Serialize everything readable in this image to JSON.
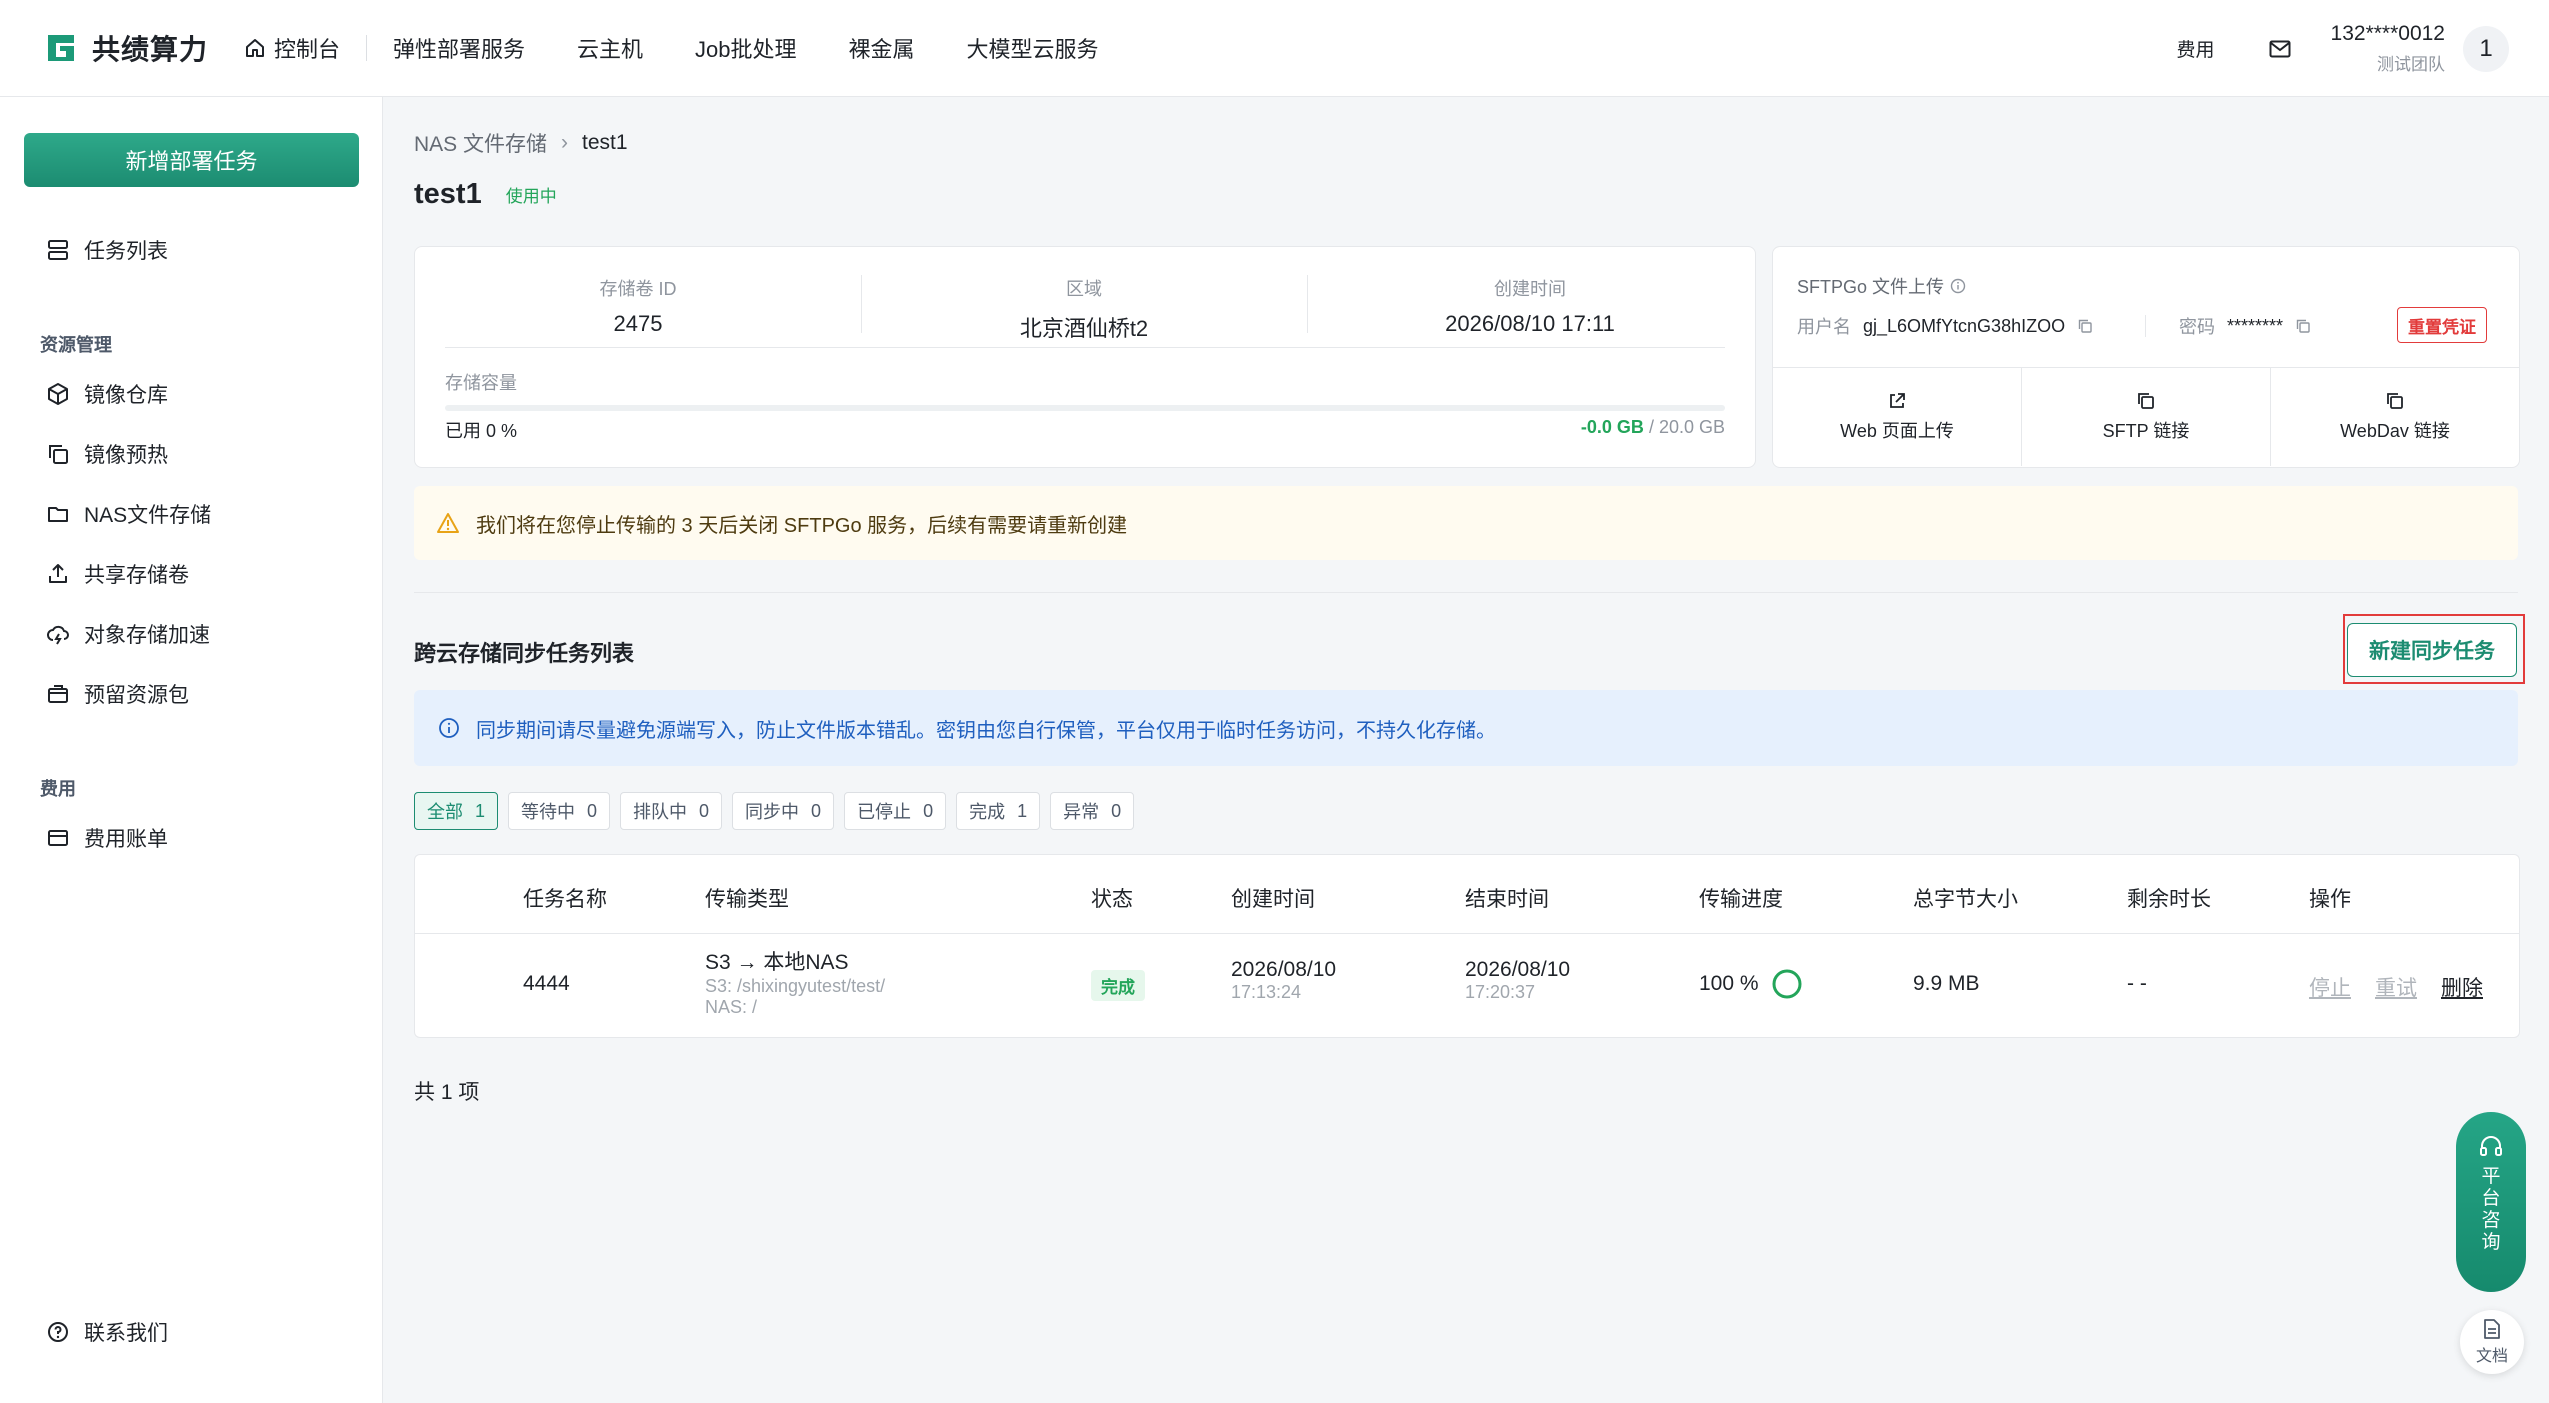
{
  "header": {
    "logo_text": "共绩算力",
    "nav": [
      "控制台",
      "弹性部署服务",
      "云主机",
      "Job批处理",
      "裸金属",
      "大模型云服务"
    ],
    "fee": "费用",
    "user_phone": "132****0012",
    "user_team": "测试团队",
    "avatar_text": "1"
  },
  "sidebar": {
    "new_task_button": "新增部署任务",
    "task_list": "任务列表",
    "group_resources": "资源管理",
    "resource_items": [
      "镜像仓库",
      "镜像预热",
      "NAS文件存储",
      "共享存储卷",
      "对象存储加速",
      "预留资源包"
    ],
    "group_fee": "费用",
    "fee_items": [
      "费用账单"
    ],
    "contact": "联系我们"
  },
  "breadcrumb": {
    "parent": "NAS 文件存储",
    "current": "test1"
  },
  "page": {
    "title": "test1",
    "status": "使用中"
  },
  "volume": {
    "id_label": "存储卷 ID",
    "id_value": "2475",
    "region_label": "区域",
    "region_value": "北京酒仙桥t2",
    "created_label": "创建时间",
    "created_value": "2026/08/10 17:11",
    "capacity_label": "存储容量",
    "used_text": "已用 0 %",
    "used_amount": "-0.0 GB",
    "total_amount": "/ 20.0 GB",
    "used_fraction": 0
  },
  "sftp": {
    "title": "SFTPGo 文件上传",
    "username_label": "用户名",
    "username_value": "gj_L6OMfYtcnG38hIZOO",
    "password_label": "密码",
    "password_value": "********",
    "reset_button": "重置凭证",
    "actions": [
      "Web 页面上传",
      "SFTP 链接",
      "WebDav 链接"
    ]
  },
  "warning_text": "我们将在您停止传输的 3 天后关闭 SFTPGo 服务，后续有需要请重新创建",
  "sync": {
    "section_title": "跨云存储同步任务列表",
    "new_button": "新建同步任务",
    "info_text": "同步期间请尽量避免源端写入，防止文件版本错乱。密钥由您自行保管，平台仅用于临时任务访问，不持久化存储。",
    "filters": [
      {
        "label": "全部",
        "count": "1"
      },
      {
        "label": "等待中",
        "count": "0"
      },
      {
        "label": "排队中",
        "count": "0"
      },
      {
        "label": "同步中",
        "count": "0"
      },
      {
        "label": "已停止",
        "count": "0"
      },
      {
        "label": "完成",
        "count": "1"
      },
      {
        "label": "异常",
        "count": "0"
      }
    ],
    "columns": [
      "任务名称",
      "传输类型",
      "状态",
      "创建时间",
      "结束时间",
      "传输进度",
      "总字节大小",
      "剩余时长",
      "操作"
    ],
    "rows": [
      {
        "name": "4444",
        "type": "S3 → 本地NAS",
        "src": "S3: /shixingyutest/test/",
        "dst": "NAS: /",
        "status": "完成",
        "created_date": "2026/08/10",
        "created_time": "17:13:24",
        "end_date": "2026/08/10",
        "end_time": "17:20:37",
        "progress": "100 %",
        "size": "9.9 MB",
        "remaining": "- -",
        "op_stop": "停止",
        "op_retry": "重试",
        "op_delete": "删除"
      }
    ],
    "total": "共 1 项"
  },
  "float": {
    "consult": "平台咨询",
    "doc": "文档"
  },
  "colors": {
    "brand": "#1c8c71",
    "success": "#23a55a",
    "danger": "#e23b3b",
    "warning_bg": "#fffbf0",
    "info_bg": "#e6f0fd"
  }
}
